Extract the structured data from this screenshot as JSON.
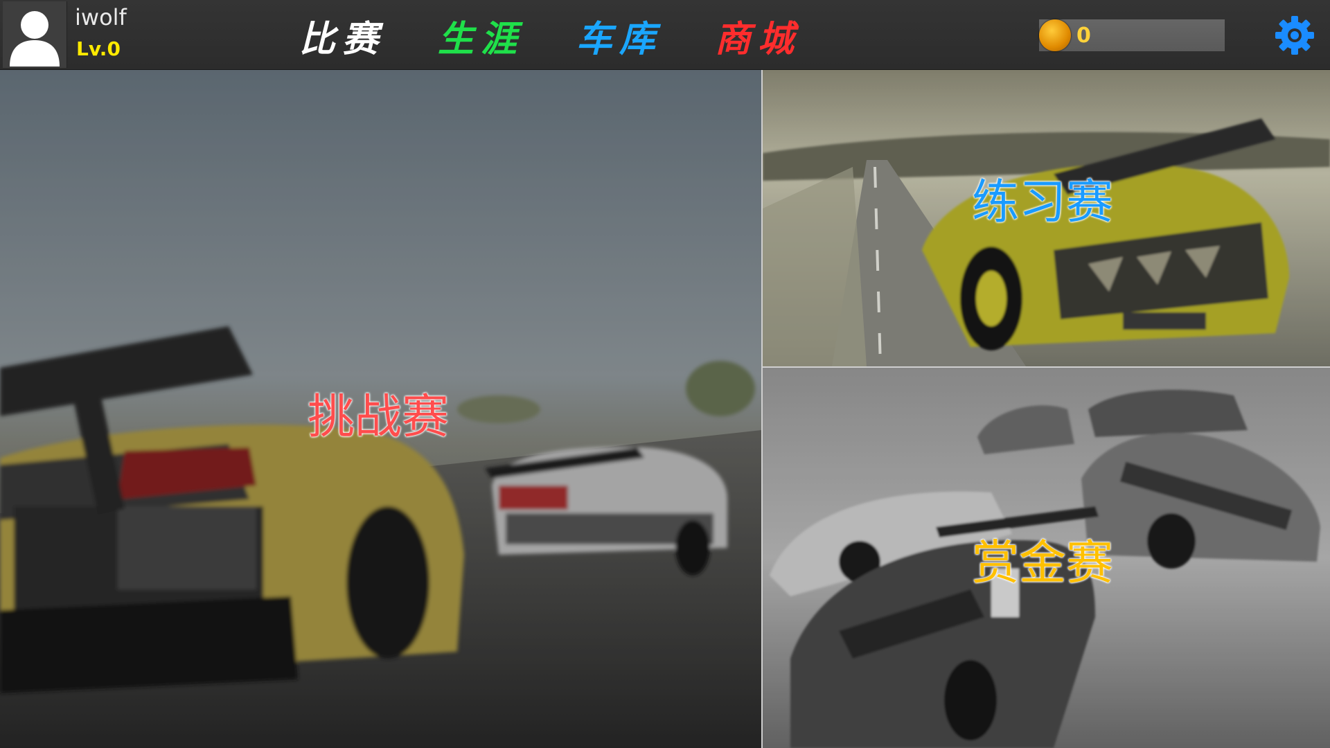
{
  "player": {
    "name": "iwolf",
    "level": "Lv.0"
  },
  "nav": {
    "tabs": [
      {
        "label": "比赛",
        "color": "#ffffff"
      },
      {
        "label": "生涯",
        "color": "#1fe04a"
      },
      {
        "label": "车库",
        "color": "#1aa6ff"
      },
      {
        "label": "商城",
        "color": "#ff2d2d"
      }
    ]
  },
  "currency": {
    "coins": "0",
    "icon": "gold-coin-icon"
  },
  "settings": {
    "icon": "gear-icon",
    "color": "#1a8cff"
  },
  "modes": {
    "challenge": {
      "label": "挑战赛",
      "color": "#ff4d4d"
    },
    "practice": {
      "label": "练习赛",
      "color": "#1a9bff"
    },
    "bounty": {
      "label": "赏金赛",
      "color": "#ffc000"
    }
  }
}
